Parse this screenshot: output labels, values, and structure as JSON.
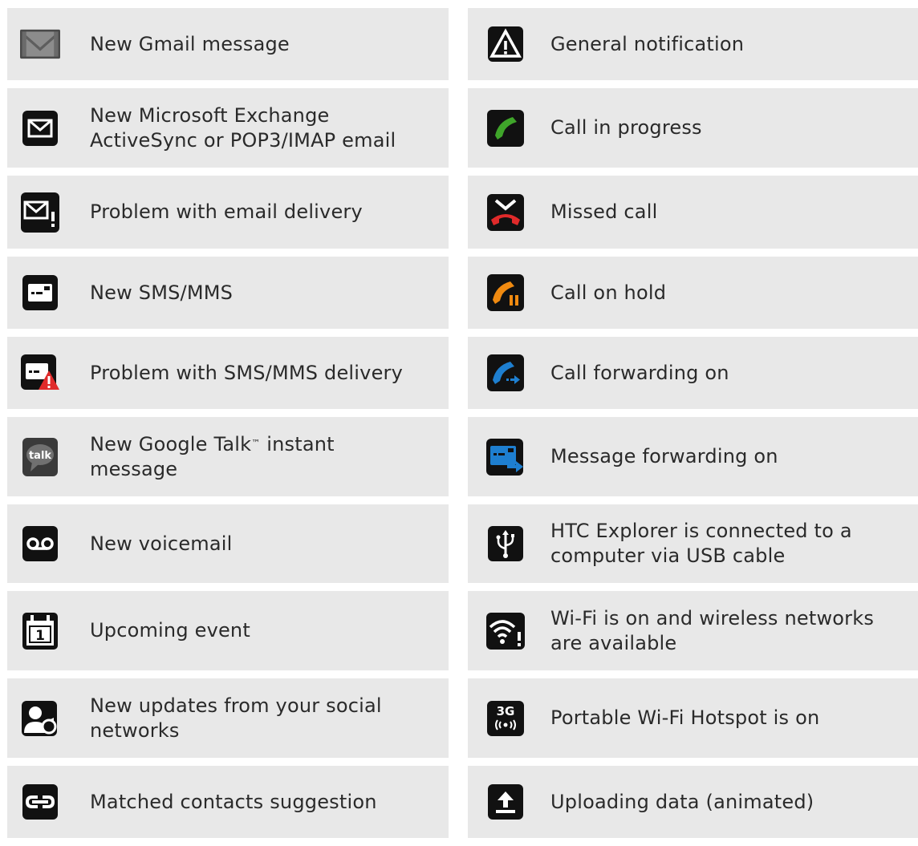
{
  "left": [
    {
      "label": "New Gmail message",
      "icon": "gmail-icon"
    },
    {
      "label": "New Microsoft Exchange ActiveSync or POP3/IMAP email",
      "icon": "exchange-email-icon"
    },
    {
      "label": "Problem with email delivery",
      "icon": "email-problem-icon"
    },
    {
      "label": "New SMS/MMS",
      "icon": "sms-icon"
    },
    {
      "label": "Problem with SMS/MMS delivery",
      "icon": "sms-problem-icon"
    },
    {
      "label": "New Google Talk™ instant message",
      "icon": "google-talk-icon"
    },
    {
      "label": "New voicemail",
      "icon": "voicemail-icon"
    },
    {
      "label": "Upcoming event",
      "icon": "calendar-icon"
    },
    {
      "label": "New updates from your social networks",
      "icon": "social-update-icon"
    },
    {
      "label": "Matched contacts suggestion",
      "icon": "contact-link-icon"
    }
  ],
  "right": [
    {
      "label": "General notification",
      "icon": "general-notification-icon"
    },
    {
      "label": "Call in progress",
      "icon": "call-in-progress-icon"
    },
    {
      "label": "Missed call",
      "icon": "missed-call-icon"
    },
    {
      "label": "Call on hold",
      "icon": "call-on-hold-icon"
    },
    {
      "label": "Call forwarding on",
      "icon": "call-forwarding-icon"
    },
    {
      "label": "Message forwarding on",
      "icon": "message-forwarding-icon"
    },
    {
      "label": "HTC Explorer is connected to a computer via USB cable",
      "icon": "usb-icon"
    },
    {
      "label": "Wi-Fi is on and wireless networks are available",
      "icon": "wifi-icon"
    },
    {
      "label": "Portable Wi-Fi Hotspot is on",
      "icon": "hotspot-3g-icon"
    },
    {
      "label": "Uploading data (animated)",
      "icon": "upload-icon"
    }
  ],
  "icon_text": {
    "talk": "talk",
    "calendar_day": "1",
    "hotspot_3g": "3G"
  },
  "colors": {
    "row_bg": "#e8e8e8",
    "text": "#2a2a2a",
    "green": "#3fa52a",
    "red": "#e02a2a",
    "orange": "#f08a10",
    "blue": "#1e7fd0"
  }
}
